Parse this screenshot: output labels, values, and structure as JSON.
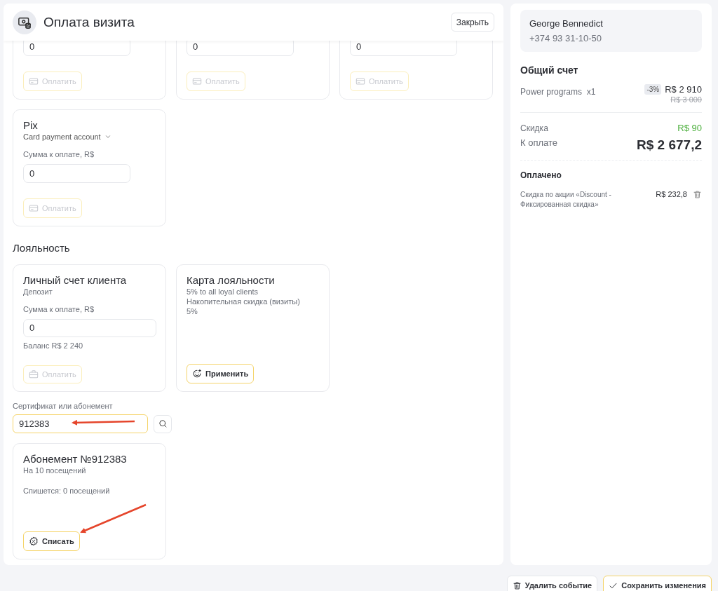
{
  "header": {
    "title": "Оплата визита",
    "close": "Закрыть"
  },
  "payment_cards": [
    {
      "amount": "0",
      "button": {
        "label": "Оплатить",
        "kind": "card",
        "disabled": true
      }
    },
    {
      "amount": "0",
      "button": {
        "label": "Оплатить",
        "kind": "card",
        "disabled": true
      }
    },
    {
      "amount": "0",
      "button": {
        "label": "Оплатить",
        "kind": "card",
        "disabled": true
      }
    },
    {
      "title": "Pix",
      "account": "Card payment account",
      "amount_label": "Сумма к оплате, R$",
      "amount": "0",
      "button": {
        "label": "Оплатить",
        "kind": "card",
        "disabled": true
      }
    }
  ],
  "loyalty": {
    "heading": "Лояльность",
    "cards": [
      {
        "title": "Личный счет клиента",
        "lines": [
          "Депозит"
        ],
        "amount_label": "Сумма к оплате, R$",
        "amount": "0",
        "balance": "Баланс R$ 2 240",
        "button": {
          "label": "Оплатить",
          "kind": "deposit",
          "disabled": true
        }
      },
      {
        "title": "Карта лояльности",
        "lines": [
          "5% to all loyal clients",
          "Накопительная скидка (визиты)",
          "5%"
        ],
        "button": {
          "label": "Применить",
          "kind": "loyalty",
          "disabled": false
        }
      }
    ]
  },
  "certificate": {
    "label": "Сертификат или абонемент",
    "value": "912383",
    "focused": true
  },
  "subscription": {
    "title": "Абонемент №912383",
    "lines": [
      "На 10 посещений"
    ],
    "note": "Спишется: 0 посещений",
    "button": {
      "label": "Списать",
      "kind": "writeoff",
      "disabled": false
    }
  },
  "client": {
    "name": "George Bennedict",
    "phone": "+374 93 31-10-50"
  },
  "bill": {
    "title": "Общий счет",
    "items": [
      {
        "name": "Power programs",
        "qty": "x1",
        "badge": "-3%",
        "price": "R$ 2 910",
        "old_price": "R$ 3 000"
      }
    ],
    "discount_label": "Скидка",
    "discount": "R$ 90",
    "total_label": "К оплате",
    "total": "R$ 2 677,2"
  },
  "paid": {
    "title": "Оплачено",
    "items": [
      {
        "text": "Скидка по акции «Discount - Фиксированная скидка»",
        "amount": "R$ 232,8"
      }
    ]
  },
  "footer": {
    "delete": "Удалить событие",
    "save": "Сохранить изменения"
  }
}
